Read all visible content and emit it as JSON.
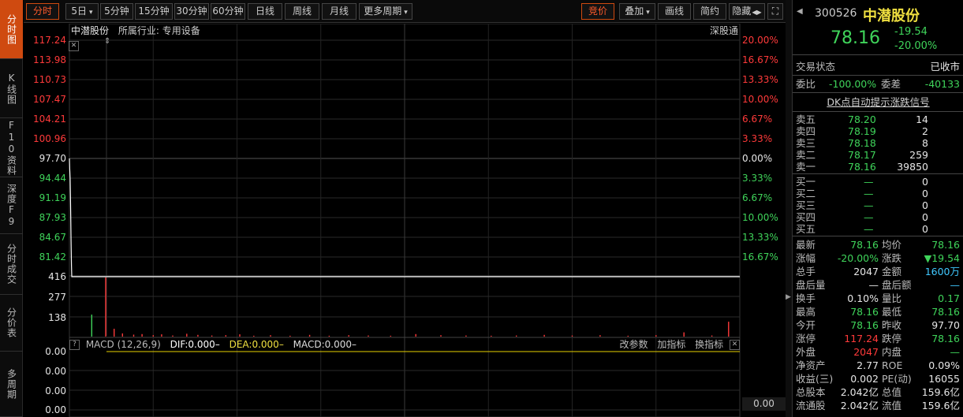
{
  "left_tabs": [
    "分时图",
    "K线图",
    "F10资料",
    "深度F9",
    "分时成交",
    "分价表",
    "多周期"
  ],
  "toolbar": {
    "buttons": [
      "分时",
      "5日",
      "5分钟",
      "15分钟",
      "30分钟",
      "60分钟",
      "日线",
      "周线",
      "月线",
      "更多周期"
    ],
    "five_day_arrow": "▾",
    "more_arrow": "▾",
    "right_buttons": [
      "竞价",
      "叠加",
      "画线",
      "简约",
      "隐藏"
    ],
    "overlay_arrow": "▾",
    "hide_arrow": "◀▶",
    "expand_icon": "⛶"
  },
  "chart": {
    "stock_name": "中潜股份",
    "industry": "所属行业: 专用设备",
    "exchange_link": "深股通",
    "close_icon": "✕",
    "price_labels": [
      "117.24",
      "113.98",
      "110.73",
      "107.47",
      "104.21",
      "100.96",
      "97.70",
      "94.44",
      "91.19",
      "87.93",
      "84.67",
      "81.42"
    ],
    "pct_labels": [
      "20.00%",
      "16.67%",
      "13.33%",
      "10.00%",
      "6.67%",
      "3.33%",
      "0.00%",
      "3.33%",
      "6.67%",
      "10.00%",
      "13.33%",
      "16.67%"
    ],
    "volume_labels": [
      "416",
      "277",
      "138"
    ],
    "macd": {
      "help": "?",
      "title": "MACD (12,26,9)",
      "dif": "DIF:0.000",
      "dea": "DEA:0.000",
      "macd": "MACD:0.000",
      "dash": "–",
      "actions": [
        "改参数",
        "加指标",
        "换指标"
      ],
      "close": "✕",
      "axis_labels": [
        "0.00",
        "0.00",
        "0.00",
        "0.00"
      ],
      "right_value": "0.00"
    },
    "colors": {
      "up": "#ff3a3a",
      "down": "#3fd45a",
      "price_line": "#ffffff",
      "macd_line": "#e6d000"
    }
  },
  "chart_data": {
    "type": "line",
    "title": "",
    "xlabel": "",
    "ylabel": "",
    "prev_close": 97.7,
    "ylim": [
      81.42,
      117.24
    ],
    "series": [
      {
        "values": [
          97.7,
          96.0,
          94.4,
          91.5,
          88.0,
          84.0,
          80.0,
          78.16,
          78.16,
          78.16,
          78.16,
          78.16
        ]
      }
    ],
    "volume_ylim": [
      0,
      416
    ],
    "volume": [
      {
        "i": 8,
        "v": 155,
        "c": "down"
      },
      {
        "i": 13,
        "v": 416,
        "c": "up"
      },
      {
        "i": 16,
        "v": 55,
        "c": "up"
      },
      {
        "i": 19,
        "v": 22,
        "c": "up"
      },
      {
        "i": 23,
        "v": 14,
        "c": "up"
      },
      {
        "i": 26,
        "v": 18,
        "c": "up"
      },
      {
        "i": 30,
        "v": 10,
        "c": "up"
      },
      {
        "i": 33,
        "v": 16,
        "c": "up"
      },
      {
        "i": 37,
        "v": 8,
        "c": "up"
      },
      {
        "i": 42,
        "v": 20,
        "c": "up"
      },
      {
        "i": 46,
        "v": 12,
        "c": "up"
      },
      {
        "i": 51,
        "v": 8,
        "c": "up"
      },
      {
        "i": 56,
        "v": 10,
        "c": "up"
      },
      {
        "i": 61,
        "v": 16,
        "c": "up"
      },
      {
        "i": 66,
        "v": 6,
        "c": "up"
      },
      {
        "i": 72,
        "v": 10,
        "c": "up"
      },
      {
        "i": 79,
        "v": 6,
        "c": "up"
      },
      {
        "i": 86,
        "v": 12,
        "c": "up"
      },
      {
        "i": 93,
        "v": 6,
        "c": "up"
      },
      {
        "i": 100,
        "v": 10,
        "c": "up"
      },
      {
        "i": 107,
        "v": 8,
        "c": "up"
      },
      {
        "i": 115,
        "v": 6,
        "c": "up"
      },
      {
        "i": 124,
        "v": 18,
        "c": "up"
      },
      {
        "i": 133,
        "v": 10,
        "c": "up"
      },
      {
        "i": 142,
        "v": 8,
        "c": "up"
      },
      {
        "i": 151,
        "v": 6,
        "c": "up"
      },
      {
        "i": 160,
        "v": 8,
        "c": "up"
      },
      {
        "i": 170,
        "v": 12,
        "c": "up"
      },
      {
        "i": 180,
        "v": 8,
        "c": "up"
      },
      {
        "i": 190,
        "v": 10,
        "c": "up"
      },
      {
        "i": 200,
        "v": 6,
        "c": "up"
      },
      {
        "i": 210,
        "v": 10,
        "c": "up"
      },
      {
        "i": 220,
        "v": 30,
        "c": "up"
      },
      {
        "i": 230,
        "v": 8,
        "c": "up"
      },
      {
        "i": 236,
        "v": 105,
        "c": "up"
      }
    ],
    "volume_total_slots": 240
  },
  "quote": {
    "code": "300526",
    "name": "中潜股份",
    "price": "78.16",
    "change": "-19.54",
    "change_pct": "-20.00%",
    "status_label": "交易状态",
    "status_value": "已收市",
    "weibi_label": "委比",
    "weibi_value": "-100.00%",
    "weicha_label": "委差",
    "weicha_value": "-40133",
    "dk_link": "DK点自动提示涨跌信号",
    "asks": [
      {
        "label": "卖五",
        "price": "78.20",
        "vol": "14"
      },
      {
        "label": "卖四",
        "price": "78.19",
        "vol": "2"
      },
      {
        "label": "卖三",
        "price": "78.18",
        "vol": "8"
      },
      {
        "label": "卖二",
        "price": "78.17",
        "vol": "259"
      },
      {
        "label": "卖一",
        "price": "78.16",
        "vol": "39850"
      }
    ],
    "bids": [
      {
        "label": "买一",
        "price": "—",
        "vol": "0"
      },
      {
        "label": "买二",
        "price": "—",
        "vol": "0"
      },
      {
        "label": "买三",
        "price": "—",
        "vol": "0"
      },
      {
        "label": "买四",
        "price": "—",
        "vol": "0"
      },
      {
        "label": "买五",
        "price": "—",
        "vol": "0"
      }
    ],
    "stats": [
      {
        "l1": "最新",
        "v1": "78.16",
        "c1": "g",
        "l2": "均价",
        "v2": "78.16",
        "c2": "g"
      },
      {
        "l1": "涨幅",
        "v1": "-20.00%",
        "c1": "g",
        "l2": "涨跌",
        "v2": "▼19.54",
        "c2": "g"
      },
      {
        "l1": "总手",
        "v1": "2047",
        "c1": "wh",
        "l2": "金额",
        "v2": "1600万",
        "c2": "c"
      },
      {
        "l1": "盘后量",
        "v1": "—",
        "c1": "wh",
        "l2": "盘后额",
        "v2": "—",
        "c2": "c"
      },
      {
        "l1": "换手",
        "v1": "0.10%",
        "c1": "wh",
        "l2": "量比",
        "v2": "0.17",
        "c2": "g"
      },
      {
        "l1": "最高",
        "v1": "78.16",
        "c1": "g",
        "l2": "最低",
        "v2": "78.16",
        "c2": "g"
      },
      {
        "l1": "今开",
        "v1": "78.16",
        "c1": "g",
        "l2": "昨收",
        "v2": "97.70",
        "c2": "wh"
      },
      {
        "l1": "涨停",
        "v1": "117.24",
        "c1": "r",
        "l2": "跌停",
        "v2": "78.16",
        "c2": "g"
      },
      {
        "l1": "外盘",
        "v1": "2047",
        "c1": "r",
        "l2": "内盘",
        "v2": "—",
        "c2": "g"
      },
      {
        "l1": "净资产",
        "v1": "2.77",
        "c1": "wh",
        "l2": "ROE",
        "v2": "0.09%",
        "c2": "wh"
      },
      {
        "l1": "收益(三)",
        "v1": "0.002",
        "c1": "wh",
        "l2": "PE(动)",
        "v2": "16055",
        "c2": "wh"
      },
      {
        "l1": "总股本",
        "v1": "2.042亿",
        "c1": "wh",
        "l2": "总值",
        "v2": "159.6亿",
        "c2": "wh"
      },
      {
        "l1": "流通股",
        "v1": "2.042亿",
        "c1": "wh",
        "l2": "流值",
        "v2": "159.6亿",
        "c2": "wh"
      }
    ],
    "nav_icon": "◀",
    "collapse_icon": "▶"
  }
}
